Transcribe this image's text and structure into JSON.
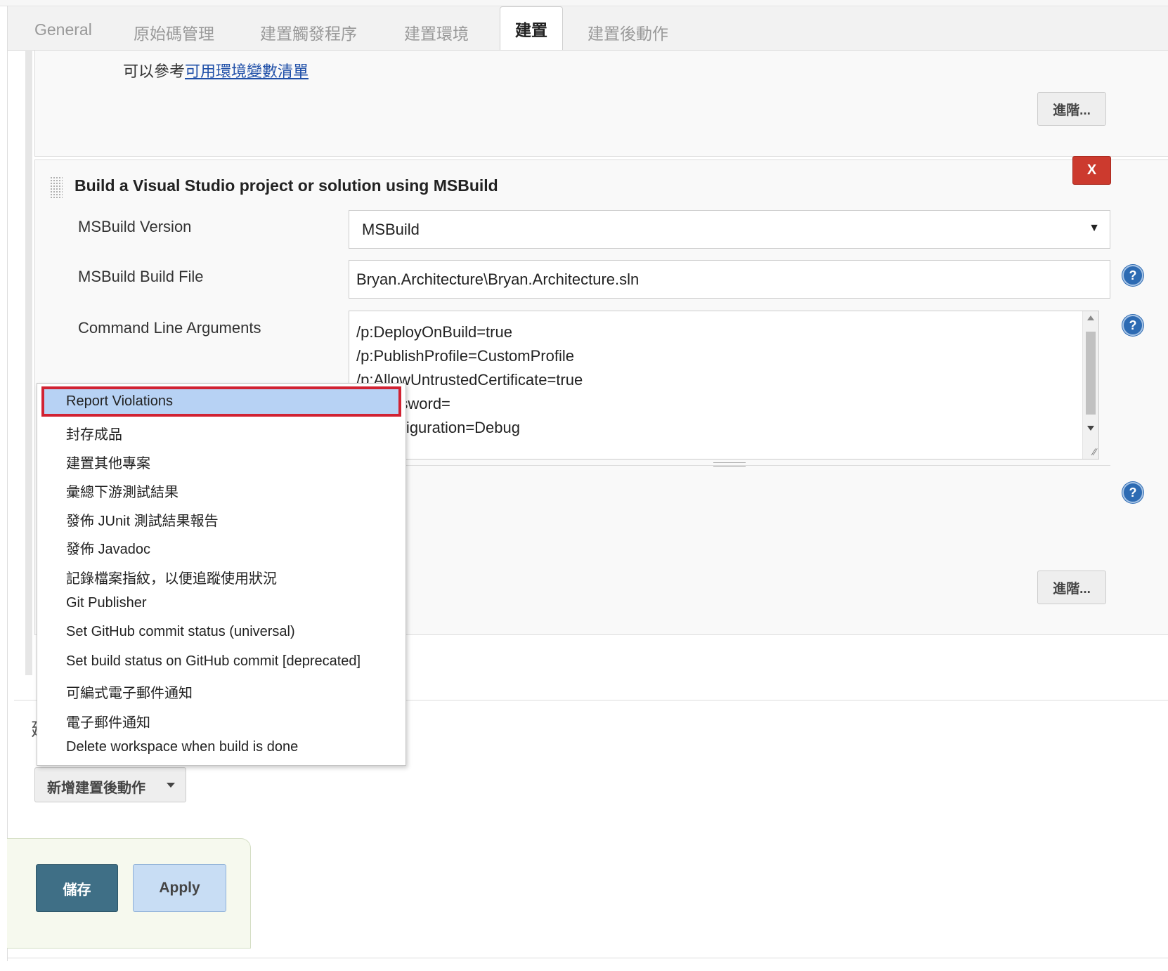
{
  "tabs": [
    {
      "label": "General"
    },
    {
      "label": "原始碼管理"
    },
    {
      "label": "建置觸發程序"
    },
    {
      "label": "建置環境"
    },
    {
      "label": "建置",
      "active": true
    },
    {
      "label": "建置後動作"
    }
  ],
  "env_hint": {
    "prefix": "可以參考",
    "link": "可用環境變數清單"
  },
  "advanced_label": "進階...",
  "build_step": {
    "title": "Build a Visual Studio project or solution using MSBuild",
    "delete_label": "X",
    "msbuild_version": {
      "label": "MSBuild Version",
      "value": "MSBuild"
    },
    "build_file": {
      "label": "MSBuild Build File",
      "value": "Bryan.Architecture\\Bryan.Architecture.sln"
    },
    "cmd_args": {
      "label": "Command Line Arguments",
      "lines": [
        "/p:DeployOnBuild=true",
        "/p:PublishProfile=CustomProfile",
        "/p:AllowUntrustedCertificate=true",
        "/p:Password=",
        "/p:Configuration=Debug"
      ]
    }
  },
  "help_icon_glyph": "?",
  "partial_label": "建",
  "post_build_menu": {
    "items": [
      "Report Violations",
      "封存成品",
      "建置其他專案",
      "彙總下游測試結果",
      "發佈 JUnit 測試結果報告",
      "發佈 Javadoc",
      "記錄檔案指紋，以便追蹤使用狀況",
      "Git Publisher",
      "Set GitHub commit status (universal)",
      "Set build status on GitHub commit [deprecated]",
      "可編式電子郵件通知",
      "電子郵件通知",
      "Delete workspace when build is done"
    ],
    "selected": "Report Violations"
  },
  "add_post_build_label": "新增建置後動作",
  "footer": {
    "save_label": "儲存",
    "apply_label": "Apply"
  },
  "colors": {
    "menu_highlight": "#b7d2f4",
    "highlight_border": "#d12232",
    "delete_button": "#cc3a2e",
    "save_button": "#3f6f86",
    "apply_button": "#c8ddf4",
    "link": "#1f4fa8",
    "help_icon": "#2d6bb3"
  }
}
